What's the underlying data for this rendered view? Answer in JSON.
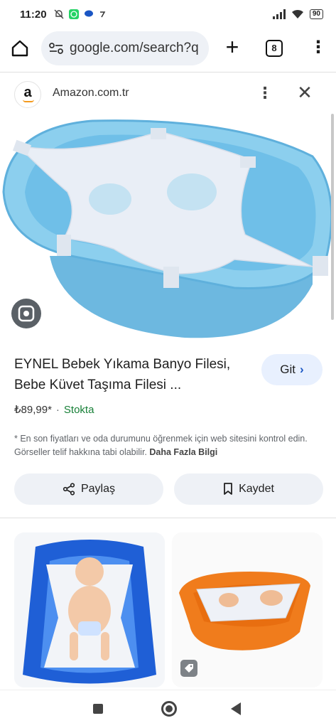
{
  "status_bar": {
    "time": "11:20",
    "battery": "90"
  },
  "browser": {
    "url": "google.com/search?q",
    "tab_count": "8"
  },
  "source": {
    "logo_letter": "a",
    "name": "Amazon.com.tr"
  },
  "product": {
    "title": "EYNEL Bebek Yıkama Banyo Filesi, Bebe Küvet Taşıma Filesi ...",
    "go_label": "Git",
    "price": "₺89,99*",
    "separator": "·",
    "stock": "Stokta",
    "disclaimer": "* En son fiyatları ve oda durumunu öğrenmek için web sitesini kontrol edin. Görseller telif hakkına tabi olabilir.",
    "more_info": "Daha Fazla Bilgi"
  },
  "actions": {
    "share_label": "Paylaş",
    "save_label": "Kaydet"
  },
  "colors": {
    "tub_blue": "#7cc6ea",
    "tub_dark_blue": "#1f5fd6",
    "tub_orange": "#f07c1c",
    "accent_blue": "#1a56c4",
    "stock_green": "#188038"
  },
  "icons": [
    "home-icon",
    "site-settings-icon",
    "plus-icon",
    "tabs-icon",
    "overflow-menu-icon",
    "more-vert-icon",
    "close-icon",
    "google-lens-icon",
    "chevron-right-icon",
    "share-icon",
    "bookmark-icon",
    "tag-icon"
  ]
}
